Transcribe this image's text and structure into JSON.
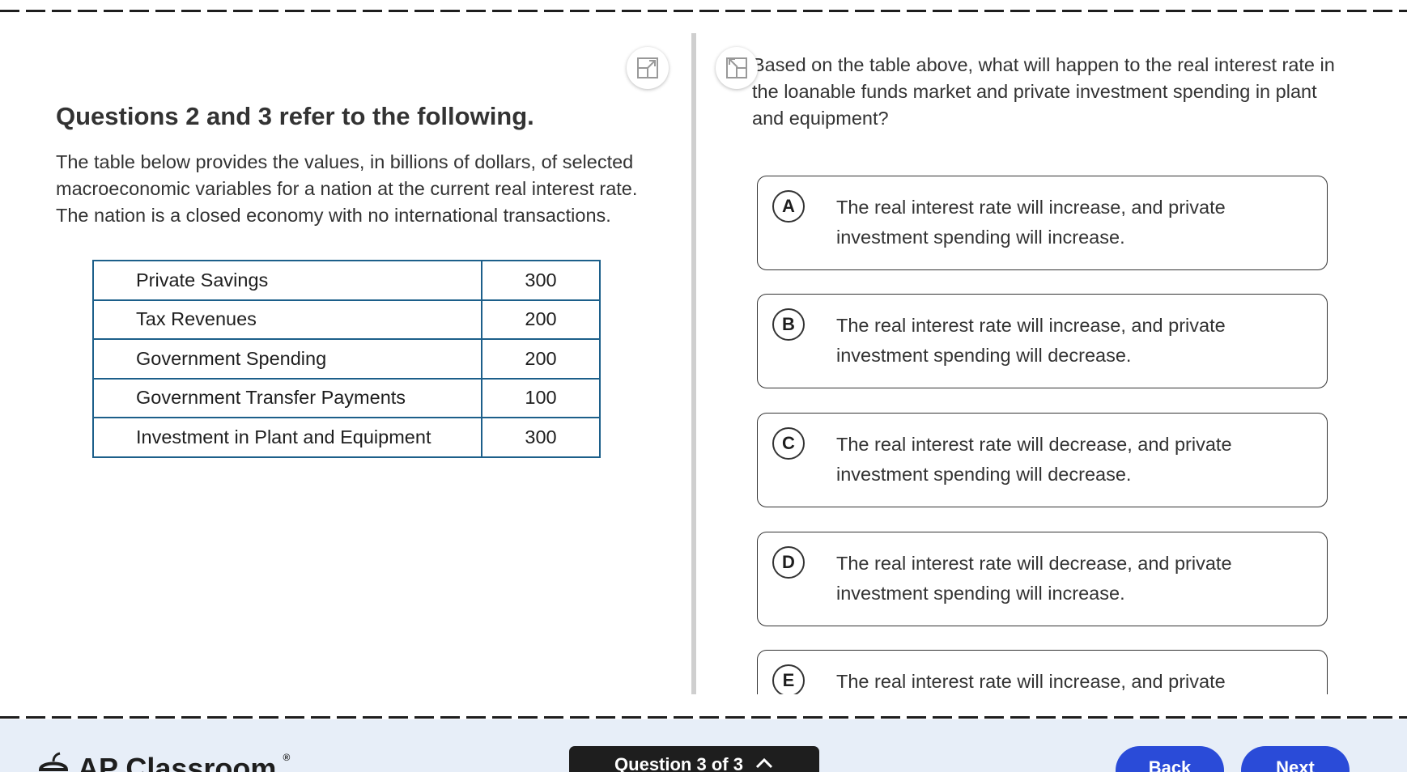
{
  "stimulus": {
    "heading": "Questions 2 and 3 refer to the following.",
    "text": "The table below provides the values, in billions of dollars, of selected macroeconomic variables for a nation at the current real interest rate. The nation is a closed economy with no international transactions.",
    "table": [
      {
        "label": "Private Savings",
        "value": "300"
      },
      {
        "label": "Tax Revenues",
        "value": "200"
      },
      {
        "label": "Government Spending",
        "value": "200"
      },
      {
        "label": "Government Transfer Payments",
        "value": "100"
      },
      {
        "label": "Investment in Plant and Equipment",
        "value": "300"
      }
    ]
  },
  "question": {
    "text": "Based on the table above, what will happen to the real interest rate in the loanable funds market and private investment spending in plant and equipment?",
    "options": [
      {
        "letter": "A",
        "text": "The real interest rate will increase, and private investment spending will increase."
      },
      {
        "letter": "B",
        "text": "The real interest rate will increase, and private investment spending will decrease."
      },
      {
        "letter": "C",
        "text": "The real interest rate will decrease, and private investment spending will decrease."
      },
      {
        "letter": "D",
        "text": "The real interest rate will decrease, and private investment spending will increase."
      },
      {
        "letter": "E",
        "text": "The real interest rate will increase, and private"
      }
    ]
  },
  "footer": {
    "logo_text": "AP Classroom",
    "logo_mark": "®",
    "question_nav": "Question 3 of 3",
    "back_label": "Back",
    "next_label": "Next"
  },
  "icons": {
    "expand": "expand-icon",
    "collapse": "collapse-icon",
    "chevron": "chevron-up-icon",
    "logo": "acorn-icon"
  },
  "colors": {
    "table_border": "#1c5f8a",
    "footer_bg": "#e7eef8",
    "nav_button": "#2a4bd8",
    "question_nav_bg": "#1e1e1e"
  }
}
